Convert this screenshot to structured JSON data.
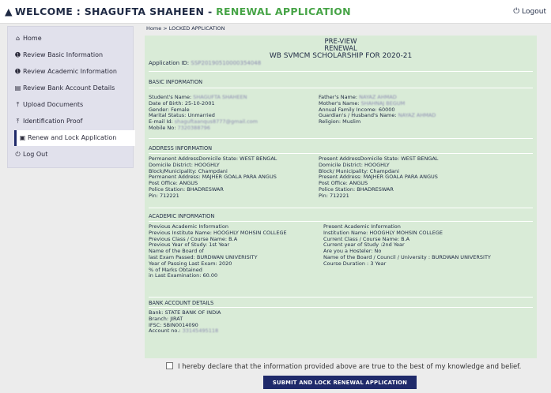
{
  "header": {
    "welcome_prefix": "WELCOME : SHAGUFTA SHAHEEN",
    "separator": " - ",
    "app_title": "RENEWAL APPLICATION",
    "logout_label": "Logout"
  },
  "sidebar": {
    "items": [
      {
        "label": "Home",
        "icon": "home-icon"
      },
      {
        "label": "Review Basic Information",
        "icon": "info-icon"
      },
      {
        "label": "Review Academic Information",
        "icon": "info-icon"
      },
      {
        "label": "Review Bank Account Details",
        "icon": "bank-icon"
      },
      {
        "label": "Upload Documents",
        "icon": "upload-icon"
      },
      {
        "label": "Identification Proof",
        "icon": "upload-icon"
      },
      {
        "label": "Renew and Lock Application",
        "icon": "lock-icon",
        "active": true
      },
      {
        "label": "Log Out",
        "icon": "power-icon"
      }
    ]
  },
  "breadcrumb": "Home > LOCKED APPLICATION",
  "preview": {
    "line1": "PRE-VIEW",
    "line2": "RENEWAL",
    "line3": "WB SVMCM SCHOLARSHIP FOR 2020-21",
    "application_id_label": "Application ID:",
    "application_id_value": "SSP20190510000354048"
  },
  "basic": {
    "title": "BASIC INFORMATION",
    "left": [
      {
        "label": "Student's Name:",
        "value": "SHAGUFTA SHAHEEN",
        "blurred": true
      },
      {
        "label": "Date of Birth:",
        "value": "25-10-2001"
      },
      {
        "label": "Gender:",
        "value": "Female"
      },
      {
        "label": "Marital Status:",
        "value": "Unmarried"
      },
      {
        "label": "E-mail Id:",
        "value": "shaguftaanqus8777@gmail.com",
        "blurred": true
      },
      {
        "label": "Mobile No:",
        "value": "7320388796",
        "blurred": true
      }
    ],
    "right": [
      {
        "label": "Father's Name:",
        "value": "NAYAZ AHMAD",
        "blurred": true
      },
      {
        "label": "Mother's Name:",
        "value": "SHAHNAJ BEGUM",
        "blurred": true
      },
      {
        "label": "Annual Family Income:",
        "value": "60000"
      },
      {
        "label": "Guardian's / Husband's Name:",
        "value": "NAYAZ AHMAD",
        "blurred": true
      },
      {
        "label": "Religion:",
        "value": "Muslim"
      }
    ]
  },
  "address": {
    "title": "ADDRESS INFORMATION",
    "left": [
      {
        "label": "Permanent AddressDomicile State:",
        "value": "WEST BENGAL"
      },
      {
        "label": "Domicile District:",
        "value": "HOOGHLY"
      },
      {
        "label": "Block/Municipality:",
        "value": "Champdani"
      },
      {
        "label": "Permanent Address:",
        "value": "MAJHER GOALA PARA ANGUS"
      },
      {
        "label": "Post Office:",
        "value": "ANGUS"
      },
      {
        "label": "Police Station:",
        "value": "BHADRESWAR"
      },
      {
        "label": "Pin:",
        "value": "712221"
      }
    ],
    "right": [
      {
        "label": "Present AddressDomicile State:",
        "value": "WEST BENGAL"
      },
      {
        "label": "Domicile District:",
        "value": "HOOGHLY"
      },
      {
        "label": "Block/ Municipality:",
        "value": "Champdani"
      },
      {
        "label": "Present Address:",
        "value": "MAJHER GOALA PARA ANGUS"
      },
      {
        "label": "Post Office:",
        "value": "ANGUS"
      },
      {
        "label": "Police Station:",
        "value": "BHADRESWAR"
      },
      {
        "label": "Pin:",
        "value": "712221"
      }
    ]
  },
  "academic": {
    "title": "ACADEMIC INFORMATION",
    "left": [
      {
        "label": "Previous Academic Information",
        "value": ""
      },
      {
        "label": "Previous Institute Name:",
        "value": "HOOGHLY MOHSIN COLLEGE"
      },
      {
        "label": "Previous Class / Course Name:",
        "value": "B.A"
      },
      {
        "label": "Previous Year of Study:",
        "value": "1st Year"
      },
      {
        "label": "Name of the Board of",
        "value": ""
      },
      {
        "label": "last Exam Passed:",
        "value": "BURDWAN UNIVERISITY"
      },
      {
        "label": "Year of Passing Last Exam:",
        "value": "2020"
      },
      {
        "label": "% of Marks Obtained",
        "value": ""
      },
      {
        "label": "in Last Examination:",
        "value": "60.00"
      }
    ],
    "right": [
      {
        "label": "Present Academic Information",
        "value": ""
      },
      {
        "label": "Institution Name:",
        "value": "HOOGHLY MOHSIN COLLEGE"
      },
      {
        "label": "Current Class / Course Name:",
        "value": "B.A"
      },
      {
        "label": "Current year of Study :",
        "value": "2nd Year"
      },
      {
        "label": "Are you a Hosteler:",
        "value": "No"
      },
      {
        "label": "Name of the Board / Council / University :",
        "value": "BURDWAN UNIVERSITY"
      },
      {
        "label": "Course Duration :",
        "value": "3 Year"
      }
    ]
  },
  "bank": {
    "title": "BANK ACCOUNT DETAILS",
    "rows": [
      {
        "label": "Bank:",
        "value": "STATE BANK OF INDIA"
      },
      {
        "label": "Branch:",
        "value": "JIRAT"
      },
      {
        "label": "IFSC:",
        "value": "SBIN0014090"
      },
      {
        "label": "Account no.:",
        "value": "33145495118",
        "blurred": true
      }
    ]
  },
  "declaration": "I hereby declare that the information provided above are true to the best of my knowledge and belief.",
  "submit_label": "SUBMIT AND LOCK RENEWAL APPLICATION"
}
